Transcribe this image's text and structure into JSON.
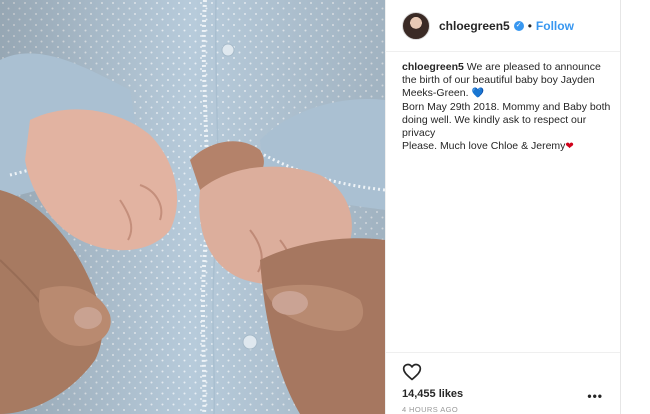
{
  "post": {
    "username": "chloegreen5",
    "follow_label": "Follow",
    "separator": "•",
    "caption": {
      "username": "chloegreen5",
      "line1": " We are pleased to announce the birth of our beautiful baby boy Jayden Meeks-Green. ",
      "line1_emoji": "💙",
      "line2": "Born May 29th 2018. Mommy and Baby both doing well. We kindly ask to respect our privacy",
      "line3": "Please. Much love Chloe & Jeremy",
      "line3_emoji": "❤"
    },
    "likes": "14,455 likes",
    "more_label": "•••",
    "timestamp": "4 HOURS AGO"
  },
  "icons": {
    "verified": "verified-badge-icon",
    "like": "heart-outline-icon",
    "more": "ellipsis-icon"
  },
  "colors": {
    "accent": "#3897f0",
    "text": "#262626",
    "muted": "#999999",
    "border": "#efefef"
  }
}
